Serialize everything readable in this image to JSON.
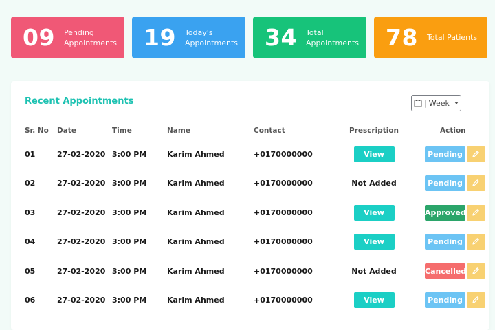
{
  "stats": [
    {
      "number": "09",
      "label": "Pending Appointments",
      "color": "#f05876"
    },
    {
      "number": "19",
      "label": "Today's Appointments",
      "color": "#3aa2f0"
    },
    {
      "number": "34",
      "label": "Total Appointments",
      "color": "#17c37a"
    },
    {
      "number": "78",
      "label": "Total Patients",
      "color": "#fa9e10"
    }
  ],
  "card": {
    "title": "Recent Appointments",
    "filter": {
      "icon": "calendar-icon",
      "label": "Week"
    }
  },
  "table": {
    "headers": [
      "Sr. No",
      "Date",
      "Time",
      "Name",
      "Contact",
      "Prescription",
      "Action"
    ],
    "rows": [
      {
        "sr": "01",
        "date": "27-02-2020",
        "time": "3:00 PM",
        "name": "Karim Ahmed",
        "contact": "+0170000000",
        "prescription": "View",
        "prescription_type": "button",
        "status": "Pending",
        "status_type": "pending"
      },
      {
        "sr": "02",
        "date": "27-02-2020",
        "time": "3:00 PM",
        "name": "Karim Ahmed",
        "contact": "+0170000000",
        "prescription": "Not Added",
        "prescription_type": "text",
        "status": "Pending",
        "status_type": "pending"
      },
      {
        "sr": "03",
        "date": "27-02-2020",
        "time": "3:00 PM",
        "name": "Karim Ahmed",
        "contact": "+0170000000",
        "prescription": "View",
        "prescription_type": "button",
        "status": "Approved",
        "status_type": "approved"
      },
      {
        "sr": "04",
        "date": "27-02-2020",
        "time": "3:00 PM",
        "name": "Karim Ahmed",
        "contact": "+0170000000",
        "prescription": "View",
        "prescription_type": "button",
        "status": "Pending",
        "status_type": "pending"
      },
      {
        "sr": "05",
        "date": "27-02-2020",
        "time": "3:00 PM",
        "name": "Karim Ahmed",
        "contact": "+0170000000",
        "prescription": "Not Added",
        "prescription_type": "text",
        "status": "Cancelled",
        "status_type": "cancelled"
      },
      {
        "sr": "06",
        "date": "27-02-2020",
        "time": "3:00 PM",
        "name": "Karim Ahmed",
        "contact": "+0170000000",
        "prescription": "View",
        "prescription_type": "button",
        "status": "Pending",
        "status_type": "pending"
      }
    ],
    "edit_icon": "pencil-icon"
  },
  "colors": {
    "accent": "#1ec2b2",
    "view_button": "#1bcfc5",
    "pending": "#6cc4f4",
    "approved": "#2ba56a",
    "cancelled": "#f56d6d",
    "edit": "#f8d172"
  }
}
